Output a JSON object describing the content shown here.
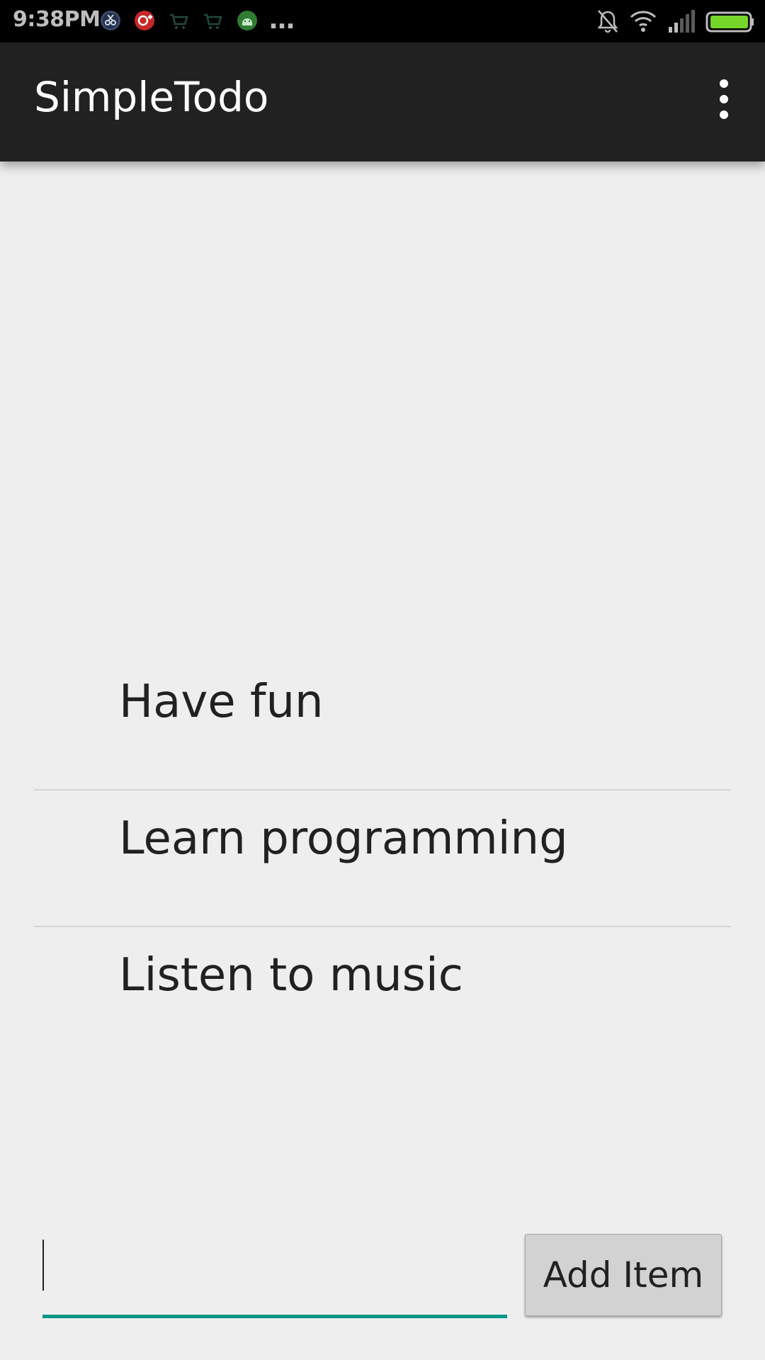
{
  "status_bar": {
    "time": "9:38PM",
    "more_indicator": "…",
    "notification_icons": [
      "scissors-icon",
      "google-plus-icon",
      "cart-icon",
      "cart-icon",
      "android-icon"
    ],
    "system_icons": [
      "bell-muted-icon",
      "wifi-icon",
      "signal-icon",
      "battery-icon"
    ],
    "battery_color": "#76d72b"
  },
  "action_bar": {
    "title": "SimpleTodo",
    "background": "#212121"
  },
  "todo_list": {
    "items": [
      {
        "label": "Have fun"
      },
      {
        "label": "Learn programming"
      },
      {
        "label": "Listen to music"
      }
    ]
  },
  "input": {
    "value": "",
    "placeholder": ""
  },
  "add_button": {
    "label": "Add Item"
  },
  "colors": {
    "accent": "#009688",
    "background": "#eeeeee",
    "divider": "#d4d4d4"
  }
}
